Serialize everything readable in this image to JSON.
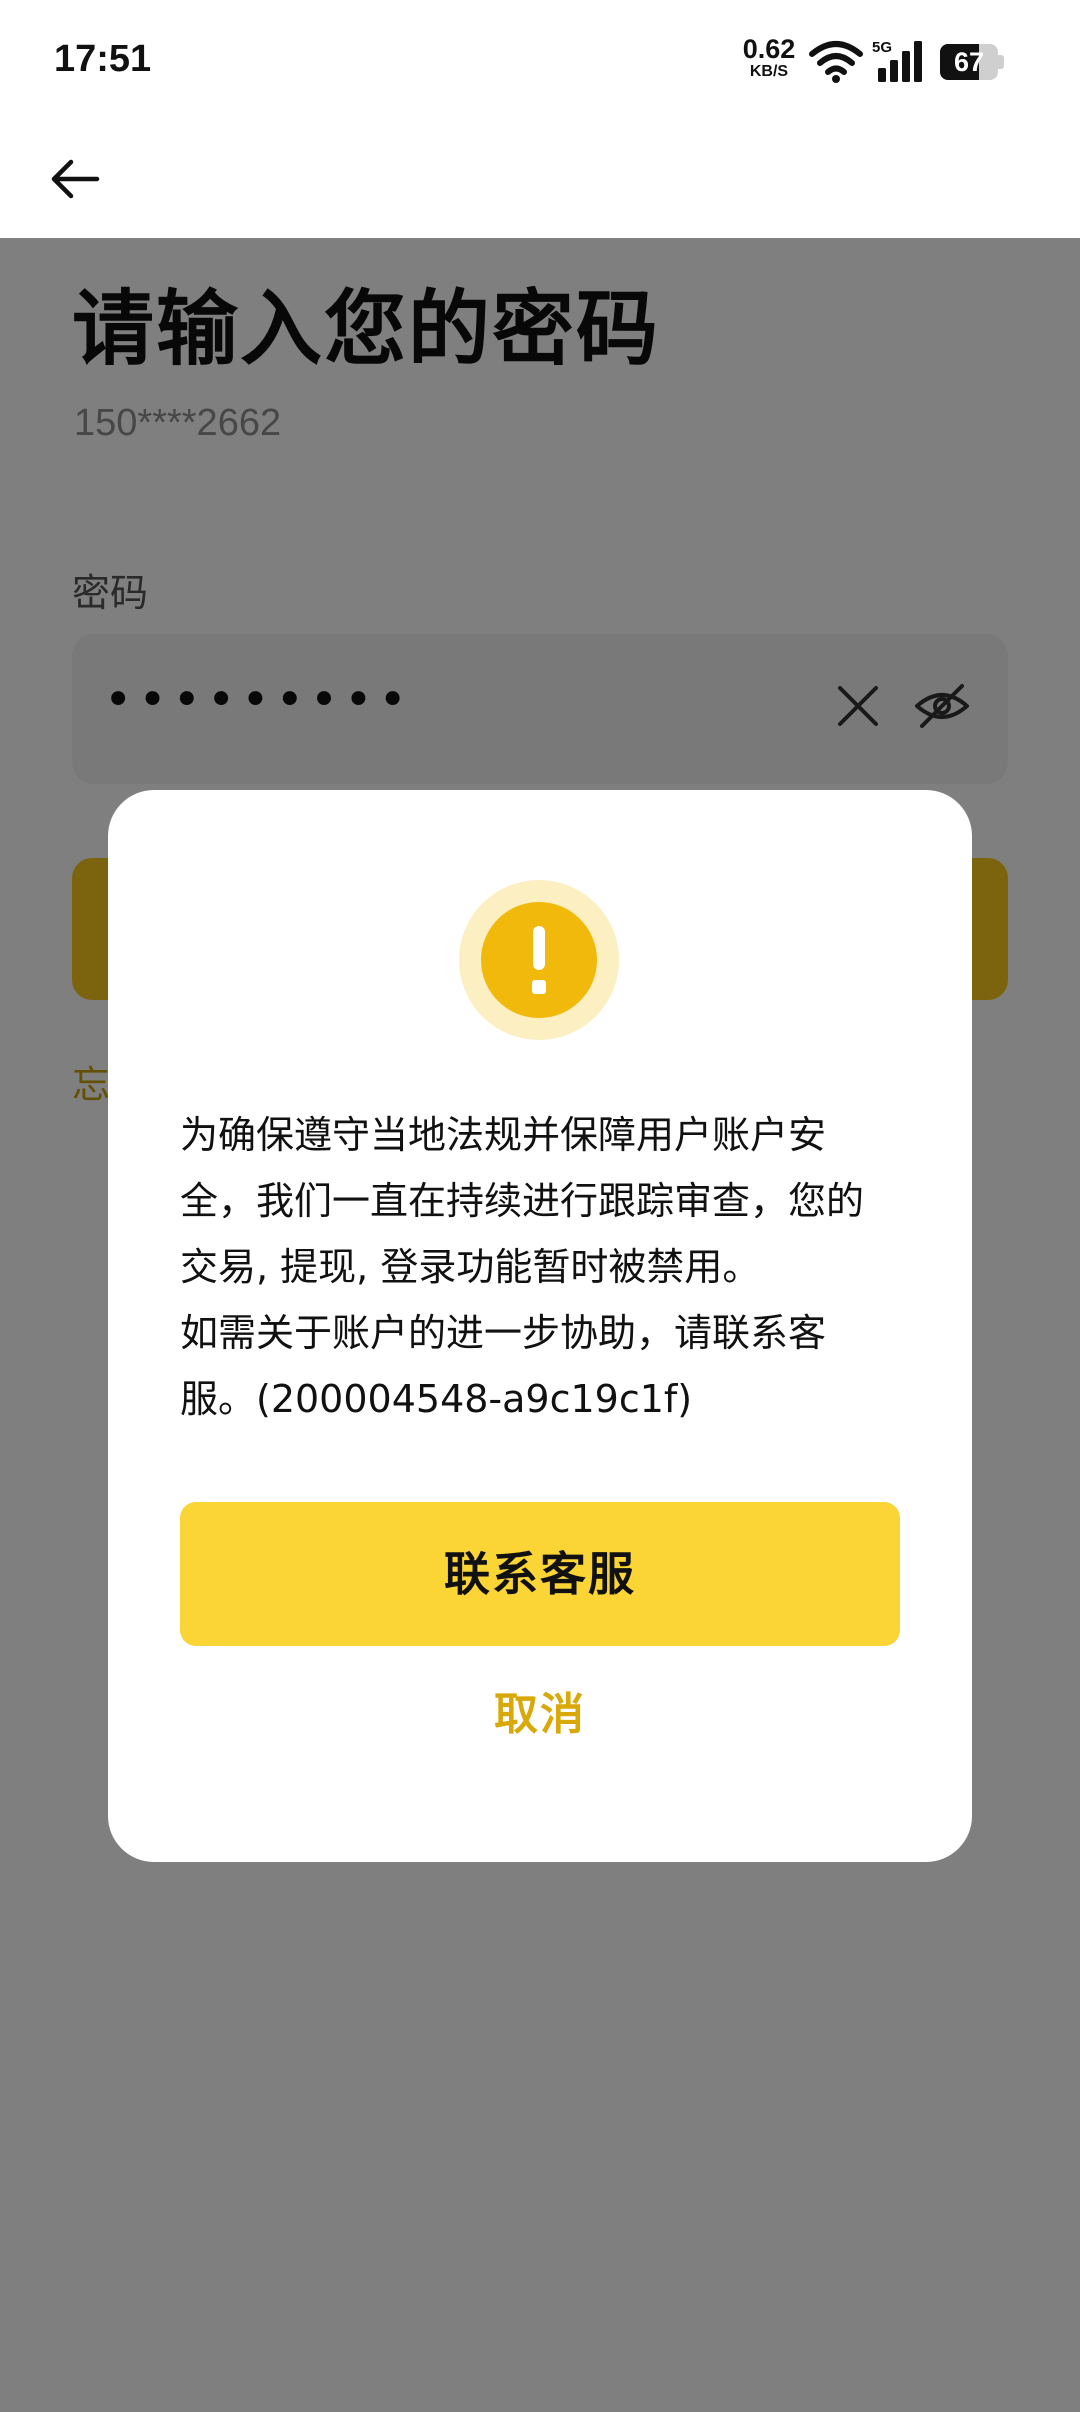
{
  "status_bar": {
    "time": "17:51",
    "net_speed": "0.62",
    "net_speed_unit": "KB/S",
    "network_type": "5G",
    "battery": "67",
    "battery_level": 0.67,
    "icons": [
      "wifi-icon",
      "signal-5g-icon",
      "battery-icon"
    ]
  },
  "header": {
    "back_icon": "arrow-left-icon"
  },
  "login": {
    "title": "请输入您的密码",
    "phone": "150****2662",
    "password_label": "密码",
    "password_value": "•••••••••",
    "clear_icon": "close-icon",
    "visibility_icon": "eye-off-icon",
    "forgot_text": "忘"
  },
  "dialog": {
    "icon": "warning-icon",
    "message": "为确保遵守当地法规并保障用户账户安全，我们一直在持续进行跟踪审查，您的交易, 提现, 登录功能暂时被禁用。\n如需关于账户的进一步协助，请联系客服。(200004548-a9c19c1f)",
    "primary_button": "联系客服",
    "secondary_button": "取消"
  },
  "colors": {
    "accent": "#fad535",
    "warning": "#f0b90b",
    "cancel_text": "#d9a90b",
    "overlay": "#808080"
  }
}
